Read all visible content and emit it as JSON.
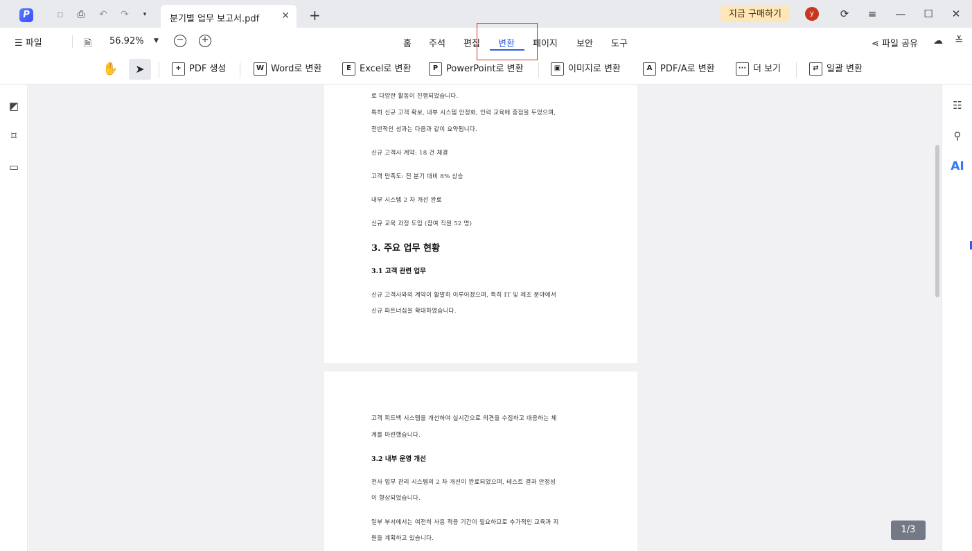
{
  "titlebar": {
    "tab_title": "분기별 업무 보고서.pdf",
    "tab_close": "✕",
    "new_tab": "+",
    "buy_label": "지금 구매하기",
    "avatar_letter": "y"
  },
  "menu": {
    "file": "☰  파일",
    "zoom": "56.92%",
    "tabs": [
      "홈",
      "주석",
      "편집",
      "변환",
      "페이지",
      "보안",
      "도구"
    ],
    "active_tab": "변환",
    "share": "파일 공유"
  },
  "toolbar": {
    "pdf_create": "PDF 생성",
    "word": "Word로 변환",
    "excel": "Excel로 변환",
    "powerpoint": "PowerPoint로 변환",
    "image": "이미지로 변환",
    "pdfa": "PDF/A로 변환",
    "more": "더 보기",
    "batch": "일괄 변환"
  },
  "icons": {
    "pdf_create": "+",
    "word": "W",
    "excel": "E",
    "powerpoint": "P",
    "image": "▣",
    "pdfa": "A",
    "more": "···",
    "batch": "⇄"
  },
  "document": {
    "page1": [
      "로 다양한 활동이 진행되었습니다.",
      "특히 신규 고객 확보, 내부 시스템 안정화, 인력 교육에 중점을 두었으며,",
      "전반적인 성과는 다음과 같이 요약됩니다.",
      "신규 고객사 계약: 18 건 체결",
      "고객 만족도: 전 분기 대비 8% 상승",
      "내부 시스템 2 차 개선 완료",
      "신규 교육 과정 도입 (참여 직원 52 명)"
    ],
    "heading3": "3. 주요 업무 현황",
    "heading31": "3.1 고객 관련 업무",
    "page1_tail": [
      "신규 고객사와의 계약이 활발히 이루어졌으며, 특히 IT 및 제조 분야에서",
      "신규 파트너십을 확대하였습니다."
    ],
    "page2_a": [
      "고객 피드백 시스템을 개선하여 실시간으로 의견을 수집하고 대응하는 체",
      "계를 마련했습니다."
    ],
    "heading32": "3.2 내부 운영 개선",
    "page2_b": [
      "전사 업무 관리 시스템의 2 차 개선이 완료되었으며, 테스트 결과 안정성",
      "이 향상되었습니다."
    ],
    "page2_c": [
      "일부 부서에서는 여전히 사용 적응 기간이 필요하므로 추가적인 교육과 지",
      "원을 계획하고 있습니다."
    ]
  },
  "page_indicator": "1/3"
}
